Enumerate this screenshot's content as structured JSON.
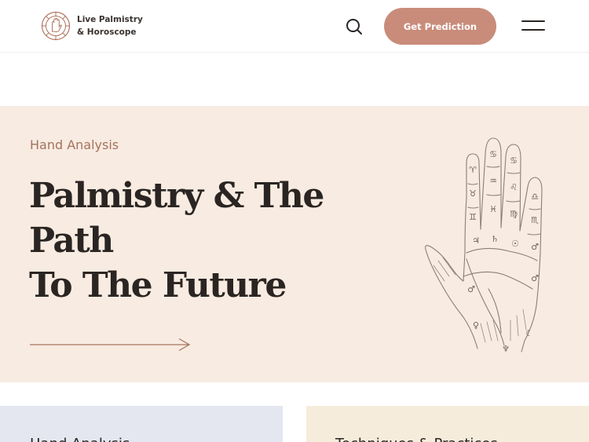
{
  "header": {
    "brand_line1": "Live Palmistry",
    "brand_line2": "& Horoscope",
    "cta_label": "Get Prediction",
    "icons": {
      "logo": "palm-logo-icon",
      "search": "search-icon",
      "menu": "hamburger-menu-icon"
    }
  },
  "hero": {
    "eyebrow": "Hand Analysis",
    "title_line1": "Palmistry & The Path",
    "title_line2": "To The Future",
    "illustration": "palmistry-hand-illustration",
    "arrow_icon": "arrow-right-icon"
  },
  "cards": [
    {
      "title": "Hand Analysis"
    },
    {
      "title": "Techniques & Practices"
    }
  ],
  "colors": {
    "accent": "#c98c7b",
    "eyebrow": "#a4735e",
    "hero_bg": "#f8ebe1",
    "card_left_bg": "#e4e6f0",
    "card_right_bg": "#f6ecdc",
    "text": "#2a2522"
  }
}
